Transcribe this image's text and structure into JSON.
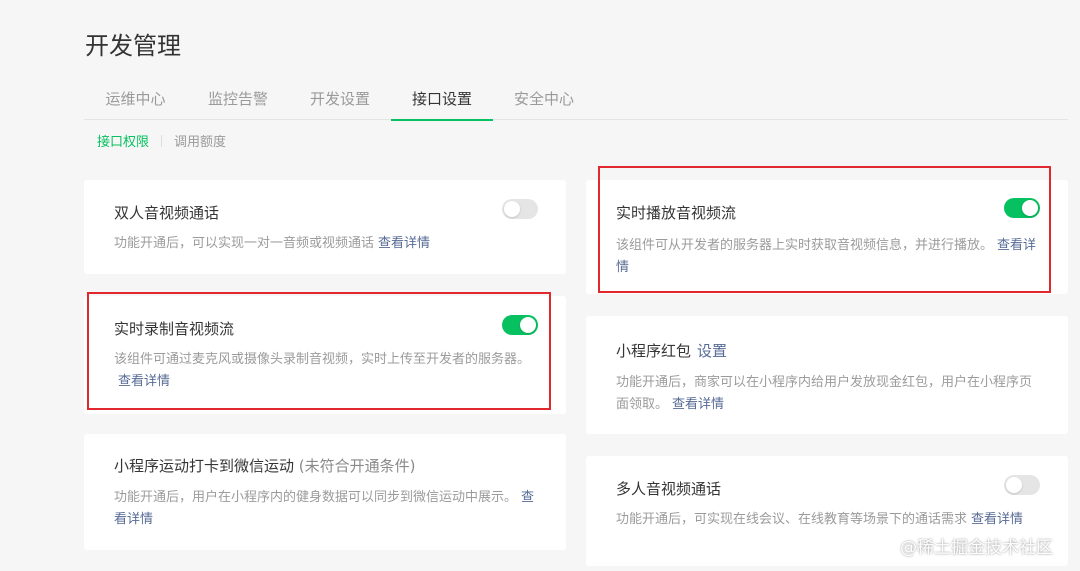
{
  "page": {
    "title": "开发管理"
  },
  "tabs": [
    {
      "label": "运维中心"
    },
    {
      "label": "监控告警"
    },
    {
      "label": "开发设置"
    },
    {
      "label": "接口设置",
      "active": true
    },
    {
      "label": "安全中心"
    }
  ],
  "subtabs": [
    {
      "label": "接口权限",
      "active": true
    },
    {
      "label": "调用额度"
    }
  ],
  "cards": {
    "duo_ren": {
      "title": "双人音视频通话",
      "desc": "功能开通后，可以实现一对一音频或视频通话",
      "link": "查看详情",
      "enabled": false
    },
    "lu_zhi": {
      "title": "实时录制音视频流",
      "desc": "该组件可通过麦克风或摄像头录制音视频，实时上传至开发者的服务器。",
      "link": "查看详情",
      "enabled": true
    },
    "yun_dong": {
      "title": "小程序运动打卡到微信运动",
      "title_note": "(未符合开通条件)",
      "desc": "功能开通后，用户在小程序内的健身数据可以同步到微信运动中展示。",
      "link": "查看详情"
    },
    "bo_fang": {
      "title": "实时播放音视频流",
      "desc": "该组件可从开发者的服务器上实时获取音视频信息，并进行播放。",
      "link": "查看详情",
      "enabled": true
    },
    "hong_bao": {
      "title": "小程序红包",
      "title_link": "设置",
      "desc": "功能开通后，商家可以在小程序内给用户发放现金红包，用户在小程序页面领取。",
      "link": "查看详情"
    },
    "duo_ren_multi": {
      "title": "多人音视频通话",
      "desc": "功能开通后，可实现在线会议、在线教育等场景下的通话需求",
      "link": "查看详情",
      "enabled": false
    }
  },
  "watermark": "@稀土掘金技术社区",
  "colors": {
    "accent": "#07c160",
    "link": "#576b95",
    "highlight": "#e0282e"
  }
}
